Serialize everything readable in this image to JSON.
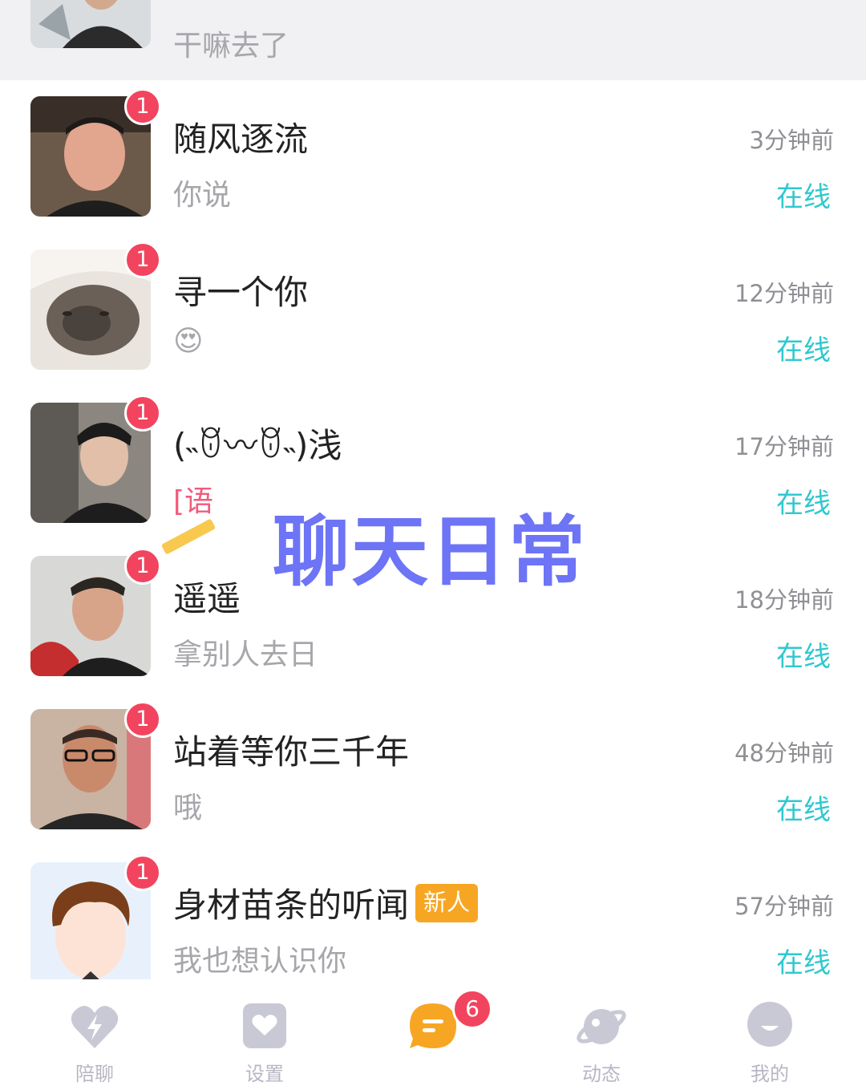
{
  "conversations": [
    {
      "name": "",
      "preview": "干嘛去了",
      "time": "",
      "status": "",
      "badge": ""
    },
    {
      "name": "随风逐流",
      "preview": "你说",
      "time": "3分钟前",
      "status": "在线",
      "badge": "1"
    },
    {
      "name": "寻一个你",
      "preview": "😍",
      "time": "12分钟前",
      "status": "在线",
      "badge": "1"
    },
    {
      "name": "(˵ꆤ〰ꆤ˵)浅",
      "preview": "[语",
      "time": "17分钟前",
      "status": "在线",
      "badge": "1"
    },
    {
      "name": "遥遥",
      "preview": "拿别人去日",
      "time": "18分钟前",
      "status": "在线",
      "badge": "1"
    },
    {
      "name": "站着等你三千年",
      "preview": "哦",
      "time": "48分钟前",
      "status": "在线",
      "badge": "1"
    },
    {
      "name": "身材苗条的听闻",
      "tag": "新人",
      "preview": "我也想认识你",
      "time": "57分钟前",
      "status": "在线",
      "badge": "1"
    }
  ],
  "overlay": {
    "title": "聊天日常"
  },
  "tabbar": {
    "tabs": [
      {
        "label": "陪聊",
        "icon": "lightning-heart-icon"
      },
      {
        "label": "设置",
        "icon": "heart-card-icon"
      },
      {
        "label": "",
        "icon": "message-bubble-icon",
        "badge": "6",
        "active": true
      },
      {
        "label": "动态",
        "icon": "planet-icon"
      },
      {
        "label": "我的",
        "icon": "profile-face-icon"
      }
    ],
    "active_color": "#f7a623",
    "inactive_color": "#b7b7c4"
  },
  "colors": {
    "online": "#2fc8cf",
    "badge": "#f2445e",
    "tag": "#f7a623"
  }
}
